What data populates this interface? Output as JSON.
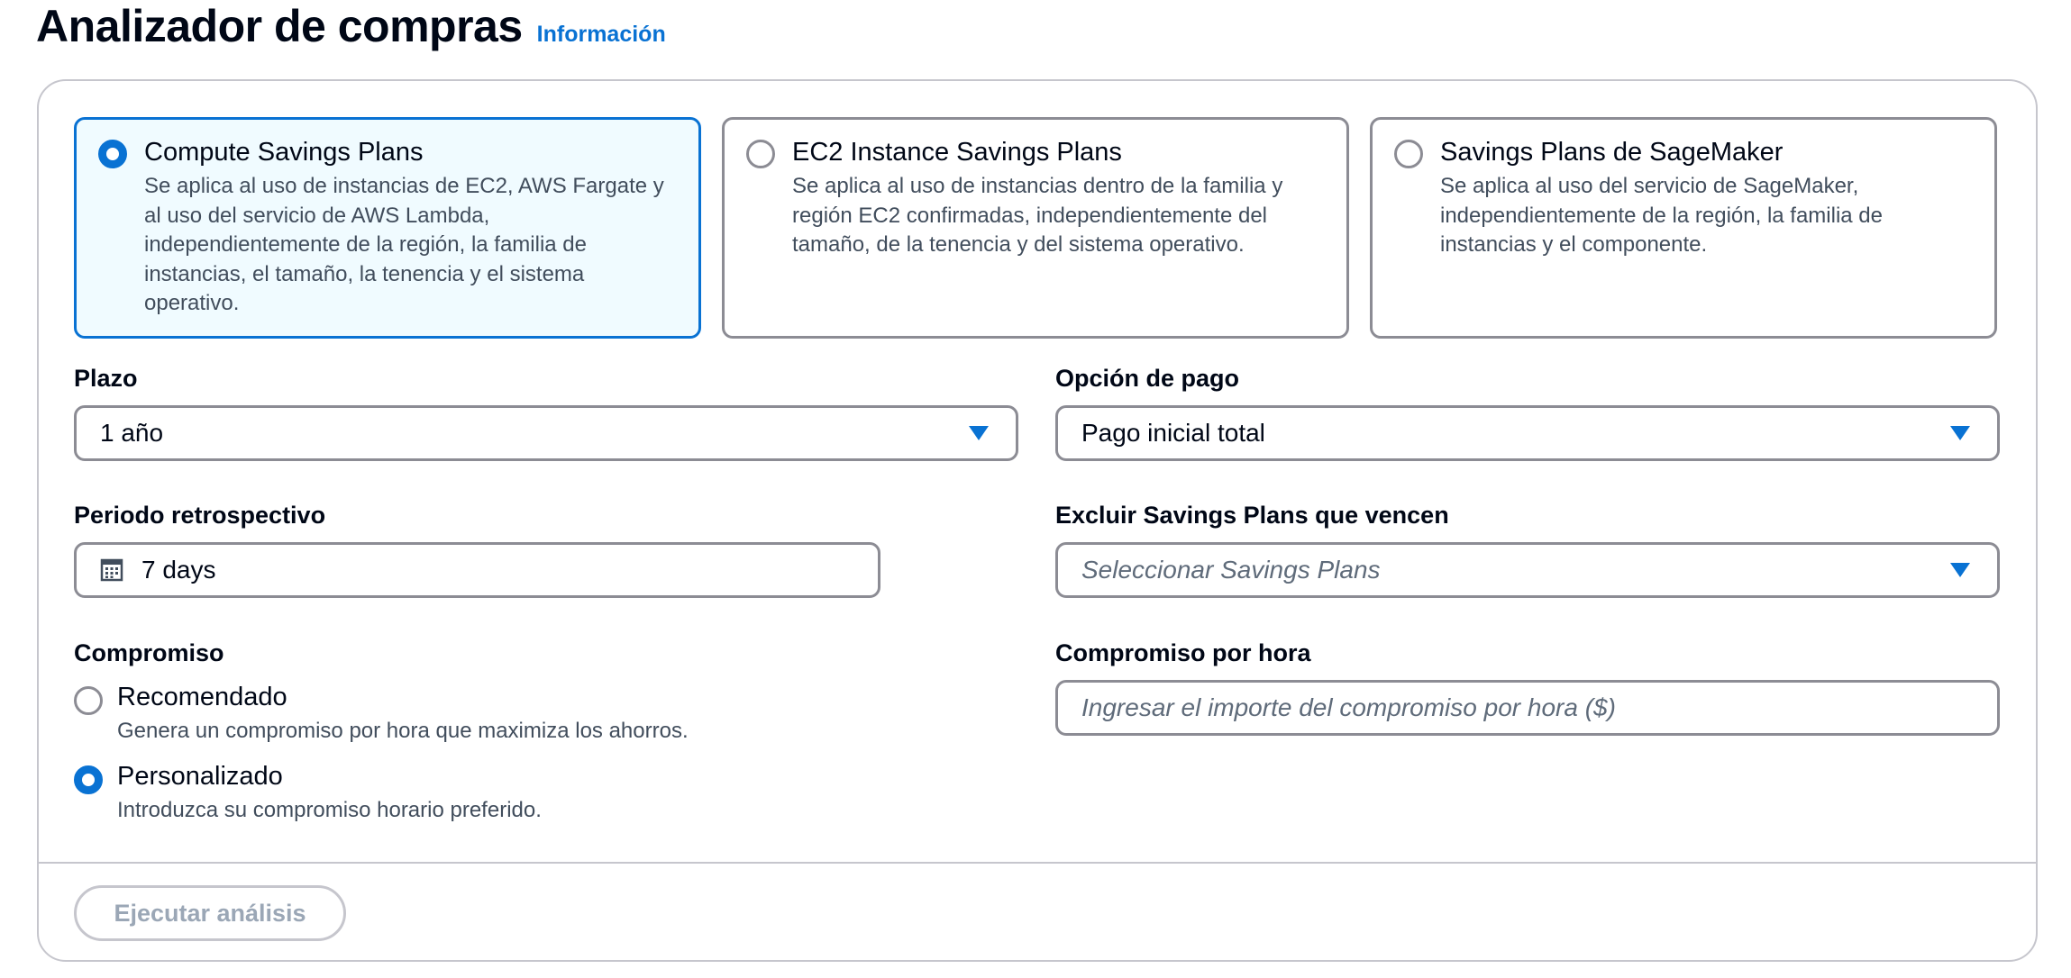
{
  "header": {
    "title": "Analizador de compras",
    "info_link": "Información"
  },
  "plan_types": [
    {
      "title": "Compute Savings Plans",
      "description": "Se aplica al uso de instancias de EC2, AWS Fargate y al uso del servicio de AWS Lambda, independientemente de la región, la familia de instancias, el tamaño, la tenencia y el sistema operativo.",
      "selected": true
    },
    {
      "title": "EC2 Instance Savings Plans",
      "description": "Se aplica al uso de instancias dentro de la familia y región EC2 confirmadas, independientemente del tamaño, de la tenencia y del sistema operativo.",
      "selected": false
    },
    {
      "title": "Savings Plans de SageMaker",
      "description": "Se aplica al uso del servicio de SageMaker, independientemente de la región, la familia de instancias y el componente.",
      "selected": false
    }
  ],
  "term": {
    "label": "Plazo",
    "value": "1 año"
  },
  "payment_option": {
    "label": "Opción de pago",
    "value": "Pago inicial total"
  },
  "lookback": {
    "label": "Periodo retrospectivo",
    "value": "7 days"
  },
  "exclude_expiring": {
    "label": "Excluir Savings Plans que vencen",
    "placeholder": "Seleccionar Savings Plans"
  },
  "commitment": {
    "label": "Compromiso",
    "options": [
      {
        "label": "Recomendado",
        "description": "Genera un compromiso por hora que maximiza los ahorros.",
        "selected": false
      },
      {
        "label": "Personalizado",
        "description": "Introduzca su compromiso horario preferido.",
        "selected": true
      }
    ]
  },
  "hourly_commitment": {
    "label": "Compromiso por hora",
    "placeholder": "Ingresar el importe del compromiso por hora ($)"
  },
  "actions": {
    "run_label": "Ejecutar análisis"
  },
  "colors": {
    "accent": "#0972d3",
    "selected_tile_bg": "#f0fbff",
    "border": "#8c8c94",
    "disabled_text": "#9ba7b6"
  }
}
